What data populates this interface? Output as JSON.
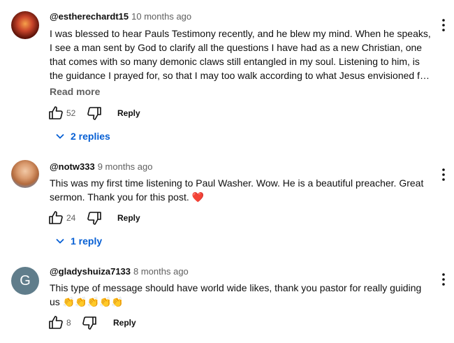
{
  "comments": [
    {
      "author": "@estherechardt15",
      "time": "10 months ago",
      "lines": [
        "I was blessed to hear Pauls Testimony recently, and he blew my mind. When he speaks,",
        "I see a man sent by God to clarify all the questions I have had as a new Christian, one",
        "that comes with so many demonic claws still entangled in my soul. Listening to him, is",
        "the guidance I prayed for, so that I may too walk according to what Jesus envisioned f…"
      ],
      "read_more": "Read more",
      "likes": "52",
      "reply_label": "Reply",
      "replies_label": "2 replies"
    },
    {
      "author": "@notw333",
      "time": "9 months ago",
      "lines": [
        "This was my first time listening to Paul Washer. Wow. He is a beautiful preacher. Great",
        "sermon. Thank you for this post."
      ],
      "emoji": "❤️",
      "likes": "24",
      "reply_label": "Reply",
      "replies_label": "1 reply"
    },
    {
      "author": "@gladyshuiza7133",
      "time": "8 months ago",
      "avatar_letter": "G",
      "lines": [
        "This type of message should have world wide likes, thank you pastor for really guiding",
        "us"
      ],
      "emoji": "👏👏👏👏👏",
      "likes": "8",
      "reply_label": "Reply"
    }
  ],
  "colors": {
    "link": "#065fd4",
    "secondary": "#606060",
    "avatar_g": "#607d8b"
  }
}
